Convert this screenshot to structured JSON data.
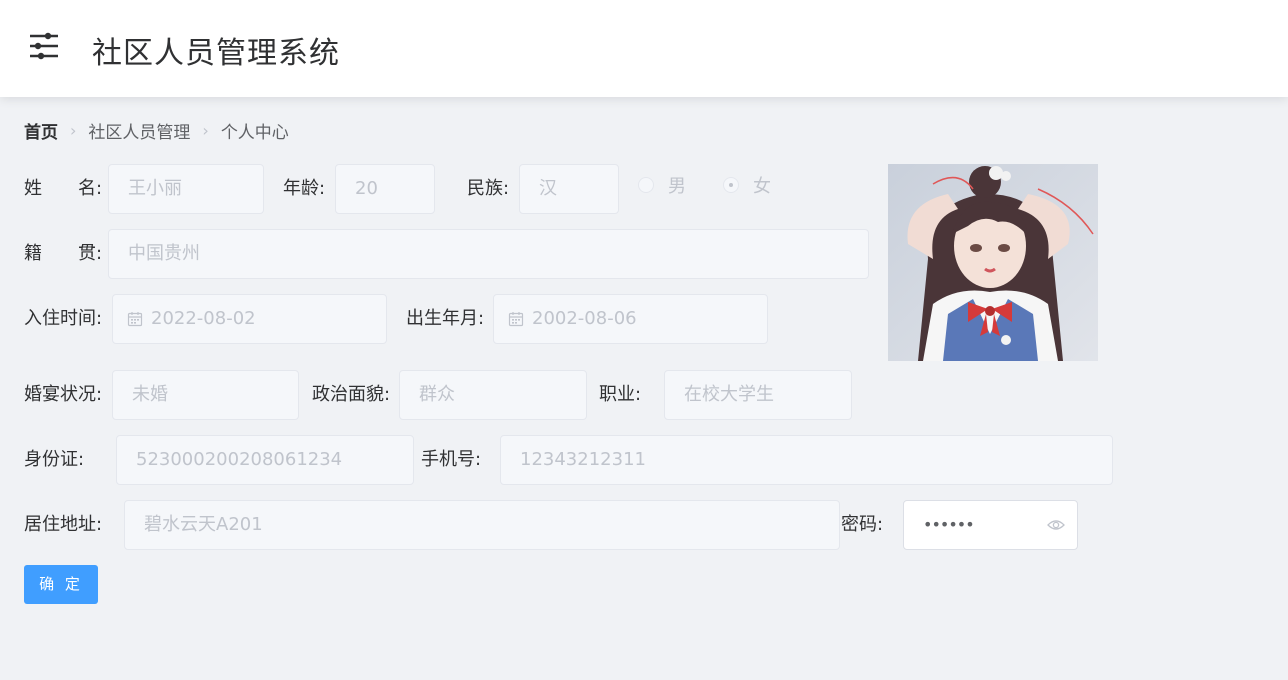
{
  "app": {
    "title": "社区人员管理系统",
    "menu_icon": "sliders-icon"
  },
  "breadcrumb": {
    "home": "首页",
    "level2": "社区人员管理",
    "current": "个人中心"
  },
  "form": {
    "name": {
      "label": "姓　　名:",
      "value": "王小丽"
    },
    "age": {
      "label": "年龄:",
      "value": "20"
    },
    "ethnicity": {
      "label": "民族:",
      "value": "汉"
    },
    "gender": {
      "options": [
        "男",
        "女"
      ],
      "selected": "女"
    },
    "native_place": {
      "label": "籍　　贯:",
      "value": "中国贵州"
    },
    "move_in_date": {
      "label": "入住时间:",
      "value": "2022-08-02"
    },
    "birth_date": {
      "label": "出生年月:",
      "value": "2002-08-06"
    },
    "marital_status": {
      "label": "婚宴状况:",
      "value": "未婚"
    },
    "political_status": {
      "label": "政治面貌:",
      "value": "群众"
    },
    "occupation": {
      "label": "职业:",
      "value": "在校大学生"
    },
    "id_card": {
      "label": "身份证:",
      "value": "523000200208061234"
    },
    "phone": {
      "label": "手机号:",
      "value": "12343212311"
    },
    "address": {
      "label": "居住地址:",
      "value": "碧水云天A201"
    },
    "password": {
      "label": "密码:",
      "masked": "••••••"
    }
  },
  "actions": {
    "confirm_label": "确 定"
  },
  "colors": {
    "primary": "#409eff",
    "page_bg": "#f0f2f5",
    "disabled_input_bg": "#f5f7fa",
    "disabled_text": "#c0c4cc"
  }
}
